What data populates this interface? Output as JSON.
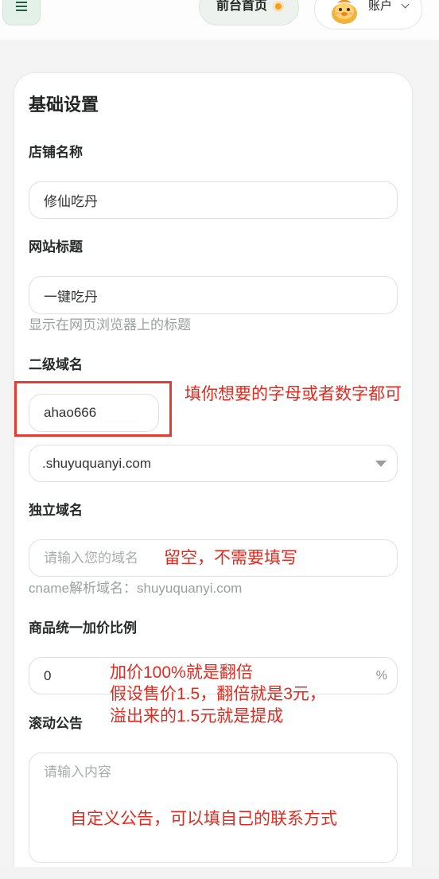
{
  "header": {
    "menu_icon": "menu-icon",
    "home_button": {
      "label": "前台首页",
      "icon": "status-dot-icon"
    },
    "account_button": {
      "label": "账户",
      "avatar": "duck-avatar",
      "icon": "chevron-down-icon"
    }
  },
  "settings": {
    "title": "基础设置",
    "shop_name": {
      "label": "店铺名称",
      "value": "修仙吃丹"
    },
    "site_title": {
      "label": "网站标题",
      "value": "一键吃丹",
      "hint": "显示在网页浏览器上的标题"
    },
    "subdomain": {
      "label": "二级域名",
      "value": "ahao666",
      "suffix": ".shuyuquanyi.com",
      "suffix_icon": "caret-down-icon"
    },
    "custom_domain": {
      "label": "独立域名",
      "placeholder": "请输入您的域名",
      "hint": "cname解析域名：shuyuquanyi.com"
    },
    "markup_ratio": {
      "label": "商品统一加价比例",
      "value": "0",
      "unit": "%"
    },
    "notice": {
      "label": "滚动公告",
      "placeholder": "请输入内容"
    }
  },
  "annotations": {
    "subdomain": "填你想要的字母或者数字都可",
    "custom_domain": "留空，不需要填写",
    "markup_ratio": [
      "加价100%就是翻倍",
      "假设售价1.5，翻倍就是3元，",
      "溢出来的1.5元就是提成"
    ],
    "notice": "自定义公告，可以填自己的联系方式"
  },
  "colors": {
    "annotation_red": "#e02b20",
    "highlight_box": "#e53b30",
    "accent_dark": "#1f5c46",
    "status_dot": "#f5a01e"
  }
}
